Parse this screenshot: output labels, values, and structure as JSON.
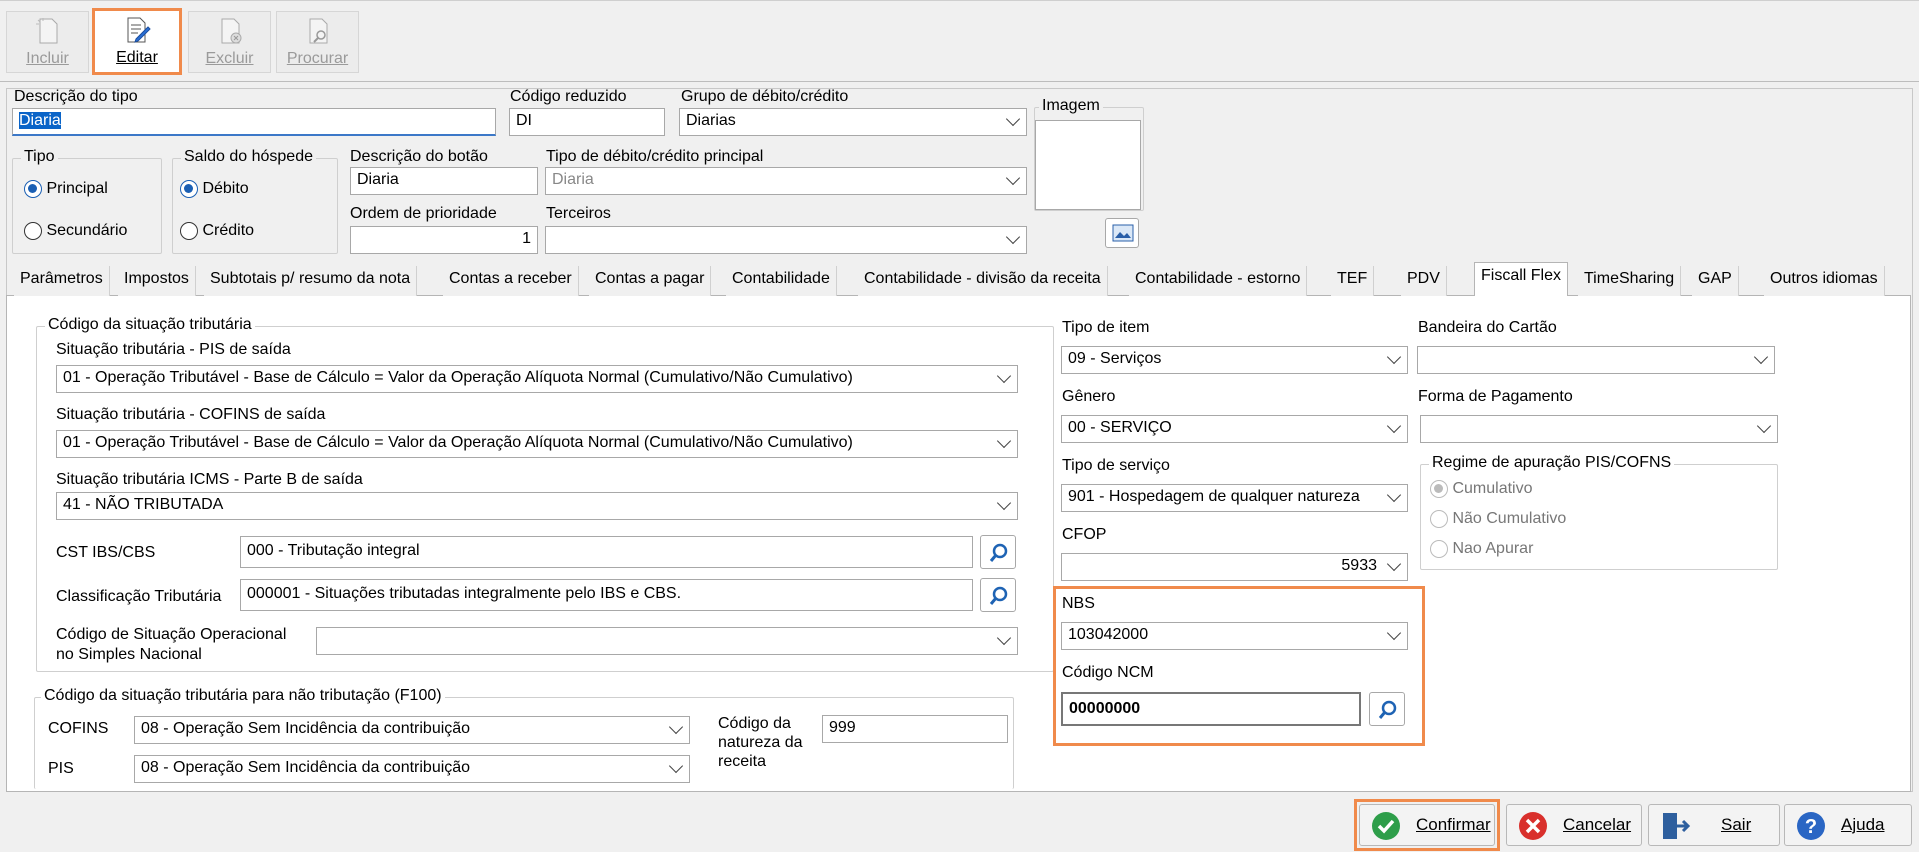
{
  "toolbar": {
    "incluir": "Incluir",
    "editar": "Editar",
    "excluir": "Excluir",
    "procurar": "Procurar"
  },
  "header": {
    "descricao_tipo_label": "Descrição do tipo",
    "descricao_tipo_value": "Diaria",
    "codigo_reduzido_label": "Código reduzido",
    "codigo_reduzido_value": "DI",
    "grupo_label": "Grupo de débito/crédito",
    "grupo_value": "Diarias",
    "imagem_label": "Imagem",
    "tipo_label": "Tipo",
    "tipo_principal": "Principal",
    "tipo_secundario": "Secundário",
    "saldo_label": "Saldo do hóspede",
    "saldo_debito": "Débito",
    "saldo_credito": "Crédito",
    "desc_botao_label": "Descrição do botão",
    "desc_botao_value": "Diaria",
    "tipo_principal_label": "Tipo de débito/crédito principal",
    "tipo_principal_value": "Diaria",
    "ordem_label": "Ordem de prioridade",
    "ordem_value": "1",
    "terceiros_label": "Terceiros",
    "terceiros_value": ""
  },
  "tabs": [
    "Parâmetros",
    "Impostos",
    "Subtotais p/ resumo da nota",
    "Contas a receber",
    "Contas a pagar",
    "Contabilidade",
    "Contabilidade - divisão da receita",
    "Contabilidade - estorno",
    "TEF",
    "PDV",
    "Fiscall Flex",
    "TimeSharing",
    "GAP",
    "Outros idiomas"
  ],
  "cst": {
    "group_title": "Código da situação tributária",
    "pis_label": "Situação tributária - PIS de saída",
    "pis_value": "01 - Operação Tributável - Base de Cálculo = Valor da Operação Alíquota Normal (Cumulativo/Não Cumulativo)",
    "cofins_label": "Situação tributária - COFINS de saída",
    "cofins_value": "01 - Operação Tributável - Base de Cálculo = Valor da Operação Alíquota Normal (Cumulativo/Não Cumulativo)",
    "icms_label": "Situação tributária ICMS -  Parte B de saída",
    "icms_value": "41 - NÃO TRIBUTADA",
    "ibs_label": "CST IBS/CBS",
    "ibs_value": "000 - Tributação integral",
    "class_label": "Classificação Tributária",
    "class_value": "000001 - Situações tributadas integralmente pelo IBS e CBS.",
    "simples_label1": "Código de Situação Operacional",
    "simples_label2": "no Simples Nacional",
    "simples_value": ""
  },
  "f100": {
    "title": "Código da situação tributária para não tributação (F100)",
    "cofins_label": "COFINS",
    "cofins_value": "08 - Operação Sem Incidência da contribuição",
    "pis_label": "PIS",
    "pis_value": "08 - Operação Sem Incidência da contribuição",
    "natureza_label1": "Código da",
    "natureza_label2": "natureza da",
    "natureza_label3": "receita",
    "natureza_value": "999"
  },
  "right": {
    "tipo_item_label": "Tipo de item",
    "tipo_item_value": "09 - Serviços",
    "genero_label": "Gênero",
    "genero_value": "00 - SERVIÇO",
    "tipo_servico_label": "Tipo de serviço",
    "tipo_servico_value": "901 - Hospedagem de qualquer natureza",
    "cfop_label": "CFOP",
    "cfop_value": "5933",
    "nbs_label": "NBS",
    "nbs_value": "103042000",
    "ncm_label": "Código NCM",
    "ncm_value": "00000000",
    "bandeira_label": "Bandeira do Cartão",
    "bandeira_value": "",
    "forma_label": "Forma de Pagamento",
    "forma_value": "",
    "regime_title": "Regime de apuração PIS/COFNS",
    "regime_cumulativo": "Cumulativo",
    "regime_nao": "Não Cumulativo",
    "regime_apurar": "Nao Apurar"
  },
  "buttons": {
    "confirmar": "Confirmar",
    "cancelar": "Cancelar",
    "sair": "Sair",
    "ajuda": "Ajuda"
  }
}
